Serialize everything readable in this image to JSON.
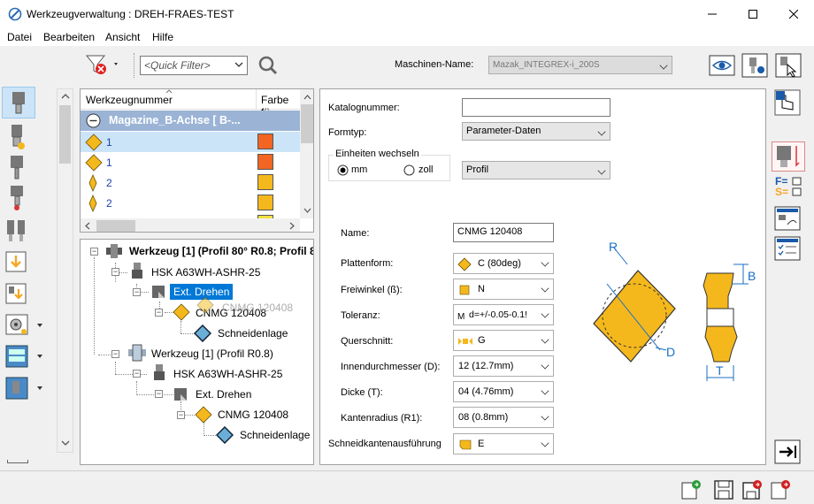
{
  "window": {
    "title": "Werkzeugverwaltung : DREH-FRAES-TEST",
    "minimize": "—",
    "maximize": "☐",
    "close": "✕"
  },
  "menu": [
    "Datei",
    "Bearbeiten",
    "Ansicht",
    "Hilfe"
  ],
  "toolbar": {
    "quick_filter_placeholder": "<Quick Filter>",
    "machine_label": "Maschinen-Name:",
    "machine_value": "Mazak_INTEGREX-i_200S"
  },
  "table": {
    "col_tool_number": "Werkzeugnummer",
    "col_color": "Farbe fü",
    "group_row": "Magazine_B-Achse [ B-...",
    "rows": [
      {
        "num": "1",
        "color": "#f26522"
      },
      {
        "num": "1",
        "color": "#f26522"
      },
      {
        "num": "2",
        "color": "#f5b81c"
      },
      {
        "num": "2",
        "color": "#f5b81c"
      }
    ]
  },
  "tree": {
    "tool1": "Werkzeug [1] (Profil 80° R0.8; Profil 8",
    "holder1": "HSK A63WH-ASHR-25",
    "op1": "Ext. Drehen",
    "insert1": "CNMG 120408",
    "insert1_ghost": "CNMG 120408",
    "edge1": "Schneidenlage",
    "tool2": "Werkzeug [1] (Profil R0.8)",
    "holder2": "HSK A63WH-ASHR-25",
    "op2": "Ext. Drehen",
    "insert2": "CNMG 120408",
    "edge2": "Schneidenlage"
  },
  "form": {
    "catalog_label": "Katalognummer:",
    "catalog_value": "",
    "formtype_label": "Formtyp:",
    "formtype_value": "Parameter-Daten",
    "units_label": "Einheiten wechseln",
    "unit_mm": "mm",
    "unit_zoll": "zoll",
    "profile_value": "Profil",
    "name_label": "Name:",
    "name_value": "CNMG 120408",
    "fields": [
      {
        "label": "Plattenform:",
        "value": "C (80deg)"
      },
      {
        "label": "Freiwinkel (ß):",
        "value": "N"
      },
      {
        "label": "Toleranz:",
        "value": "d=+/-0.05-0.1!",
        "prefix": "M"
      },
      {
        "label": "Querschnitt:",
        "value": "G"
      },
      {
        "label": "Innendurchmesser (D):",
        "value": "12 (12.7mm)"
      },
      {
        "label": "Dicke (T):",
        "value": "04 (4.76mm)"
      },
      {
        "label": "Kantenradius (R1):",
        "value": "08 (0.8mm)"
      },
      {
        "label": "Schneidkantenausführung",
        "value": "E"
      }
    ]
  },
  "diagram": {
    "R": "R",
    "D": "D",
    "B": "B",
    "T": "T"
  },
  "right_icons": {
    "F": "F=",
    "S": "S="
  }
}
